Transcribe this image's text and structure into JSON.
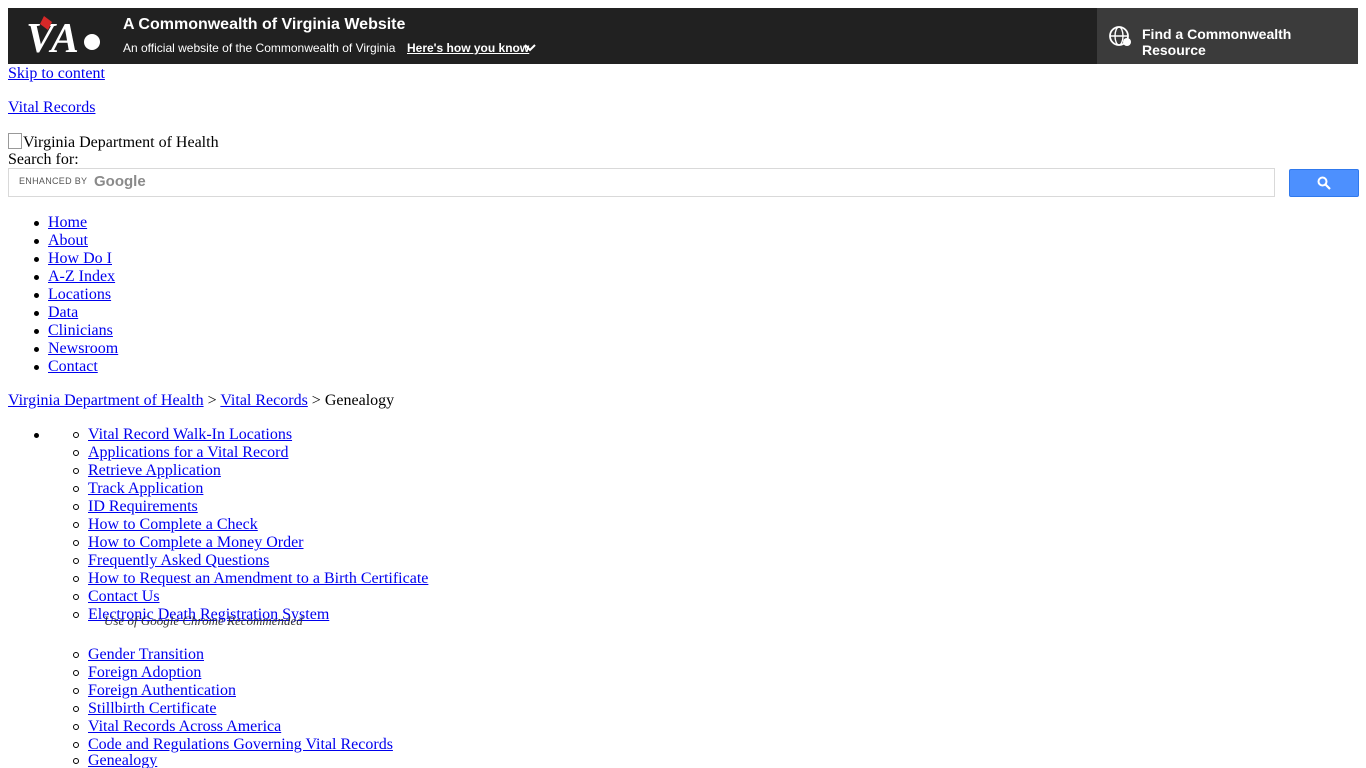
{
  "banner": {
    "title": "A Commonwealth of Virginia Website",
    "subtitle": "An official website of the Commonwealth of Virginia",
    "how_link": "Here's how you know",
    "find_resource": "Find a Commonwealth Resource"
  },
  "skip_link": "Skip to content",
  "site_link": "Vital Records",
  "logo_alt": "Virginia Department of Health",
  "search": {
    "label": "Search for:",
    "enhanced_by": "ENHANCED BY",
    "google": "Google"
  },
  "nav": [
    "Home",
    "About",
    "How Do I",
    "A-Z Index",
    "Locations",
    "Data",
    "Clinicians",
    "Newsroom",
    "Contact"
  ],
  "breadcrumb": {
    "root": "Virginia Department of Health",
    "section": "Vital Records",
    "current": "Genealogy",
    "separator": ">"
  },
  "submenu": [
    "Vital Record Walk-In Locations",
    "Applications for a Vital Record",
    "Retrieve Application",
    "Track Application",
    "ID Requirements",
    "How to Complete a Check",
    "How to Complete a Money Order",
    "Frequently Asked Questions",
    "How to Request an Amendment to a Birth Certificate",
    "Contact Us",
    "Electronic Death Registration System"
  ],
  "submenu_note": "Use of Google Chrome Recommended",
  "submenu2": [
    "Gender Transition",
    "Foreign Adoption",
    "Foreign Authentication",
    "Stillbirth Certificate",
    "Vital Records Across America",
    "Code and Regulations Governing Vital Records",
    "Genealogy"
  ]
}
